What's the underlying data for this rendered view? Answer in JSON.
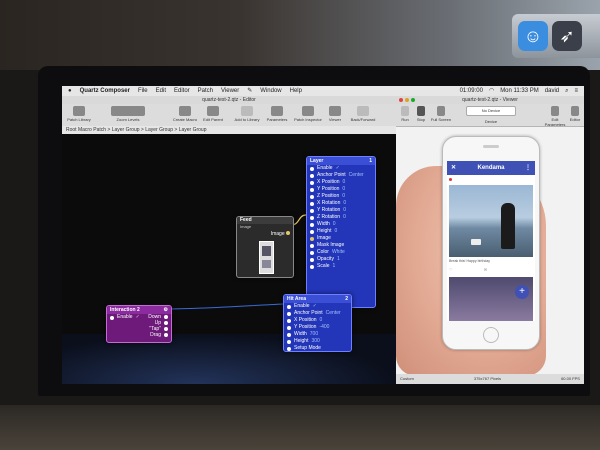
{
  "menubar": {
    "apple": "",
    "items": [
      "Quartz Composer",
      "File",
      "Edit",
      "Editor",
      "Patch",
      "Viewer",
      "",
      "Window",
      "Help"
    ],
    "clock": "Mon 11:33 PM",
    "user": "david",
    "battery": "01:09:00"
  },
  "editor": {
    "title": "quartz-test-2.qtz - Editor",
    "toolbar": [
      "Patch Library",
      "Zoom Levels",
      "Create Macro",
      "Edit Parent",
      "Add to Library",
      "Parameters",
      "Patch Inspector",
      "Viewer",
      "Back/Forward"
    ],
    "breadcrumb": "Root Macro Patch > Layer Group > Layer Group > Layer Group"
  },
  "patches": {
    "layer": {
      "title": "Layer",
      "badge": "1",
      "ports": [
        {
          "label": "Enable",
          "value": "✓"
        },
        {
          "label": "Anchor Point",
          "value": "Center"
        },
        {
          "label": "X Position",
          "value": "0"
        },
        {
          "label": "Y Position",
          "value": "0"
        },
        {
          "label": "Z Position",
          "value": "0"
        },
        {
          "label": "X Rotation",
          "value": "0"
        },
        {
          "label": "Y Rotation",
          "value": "0"
        },
        {
          "label": "Z Rotation",
          "value": "0"
        },
        {
          "label": "Width",
          "value": "0"
        },
        {
          "label": "Height",
          "value": "0"
        },
        {
          "label": "Image",
          "value": ""
        },
        {
          "label": "Mask Image",
          "value": ""
        },
        {
          "label": "Color",
          "value": "White"
        },
        {
          "label": "Opacity",
          "value": "1"
        },
        {
          "label": "Scale",
          "value": "1"
        }
      ]
    },
    "feed": {
      "title": "Feed",
      "sub": "Image",
      "out": "Image"
    },
    "interaction": {
      "title": "Interaction 2",
      "inputs": [
        {
          "label": "Enable",
          "value": "✓"
        }
      ],
      "outputs": [
        "Down",
        "Up",
        "\"Tap\"",
        "Drag"
      ]
    },
    "hitarea": {
      "title": "Hit Area",
      "badge": "2",
      "ports": [
        {
          "label": "Enable",
          "value": "✓"
        },
        {
          "label": "Anchor Point",
          "value": "Center"
        },
        {
          "label": "X Position",
          "value": "0"
        },
        {
          "label": "Y Position",
          "value": "-400"
        },
        {
          "label": "Width",
          "value": "700"
        },
        {
          "label": "Height",
          "value": "300"
        },
        {
          "label": "Setup Mode",
          "value": ""
        }
      ]
    }
  },
  "viewer": {
    "title": "quartz-test-2.qtz - Viewer",
    "toolbar": [
      "Run",
      "Stop",
      "Full Screen",
      "No Device",
      "Device",
      "Edit Parameters",
      "Editor"
    ],
    "footer": {
      "left": "Custom",
      "center": "375x767 Pixels",
      "right": "60.00 FPS"
    }
  },
  "app": {
    "title": "Kendama",
    "caption": "Break this! Happy birthday",
    "fab": "+"
  },
  "colors": {
    "patch_blue": "#2335b8",
    "patch_purple": "#6d1a7a",
    "app_bar": "#3f51b5"
  }
}
